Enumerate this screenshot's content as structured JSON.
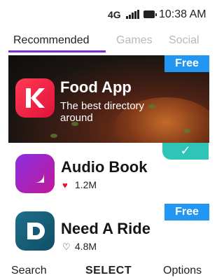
{
  "status": {
    "network": "4G",
    "time": "10:38 AM"
  },
  "tabs": [
    {
      "label": "Recommended",
      "active": true
    },
    {
      "label": "Games",
      "active": false
    },
    {
      "label": "Social",
      "active": false
    }
  ],
  "featured": {
    "badge": "Free",
    "app_name": "Food App",
    "description": "The best directory around",
    "icon": "k-logo-icon"
  },
  "installed_badge": "✓",
  "apps": [
    {
      "name": "Audio Book",
      "count": "1.2M",
      "heart": "♥",
      "heart_filled": true,
      "icon": "a-logo-icon"
    },
    {
      "name": "Need A Ride",
      "count": "4.8M",
      "heart": "♡",
      "heart_filled": false,
      "badge": "Free",
      "icon": "d-logo-icon"
    }
  ],
  "softkeys": {
    "left": "Search",
    "center": "SELECT",
    "right": "Options"
  },
  "colors": {
    "accent": "#7b2fd1",
    "badge_blue": "#2196f3",
    "badge_teal": "#2ec4b6",
    "heart_red": "#e0123a"
  }
}
